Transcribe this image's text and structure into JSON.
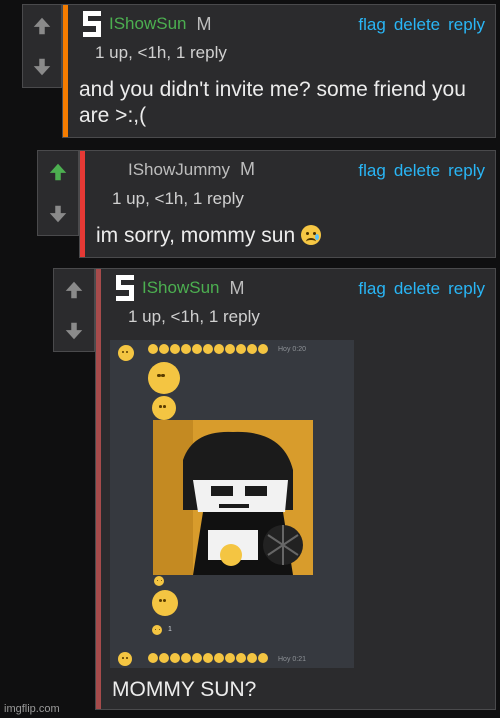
{
  "comments": [
    {
      "username": "IShowSun",
      "badge": "M",
      "meta": "1 up, <1h, 1 reply",
      "body": "and you didn't invite me? some friend you are >:,(",
      "actions": [
        "flag",
        "delete",
        "reply"
      ],
      "username_color": "#4caf50",
      "bar_color": "#f57c00",
      "upvoted": false
    },
    {
      "username": "IShowJummy",
      "badge": "M",
      "meta": "1 up, <1h, 1 reply",
      "body": "im sorry, mommy sun",
      "emoji": "crying-face",
      "actions": [
        "flag",
        "delete",
        "reply"
      ],
      "username_color": "#bdbdbd",
      "bar_color": "#e53935",
      "upvoted": true
    },
    {
      "username": "IShowSun",
      "badge": "M",
      "meta": "1 up, <1h, 1 reply",
      "body": "MOMMY SUN?",
      "actions": [
        "flag",
        "delete",
        "reply"
      ],
      "username_color": "#4caf50",
      "bar_color": "#a64b4b",
      "upvoted": false
    }
  ],
  "embedded_screenshot": {
    "time_top": "Hoy 0:20",
    "time_bottom": "Hoy 0:21",
    "reaction_count": "1"
  },
  "colors": {
    "link": "#29b6f6",
    "upvote_active": "#4caf50",
    "arrow_inactive": "#8a8a8a"
  },
  "watermark": "imgflip.com"
}
